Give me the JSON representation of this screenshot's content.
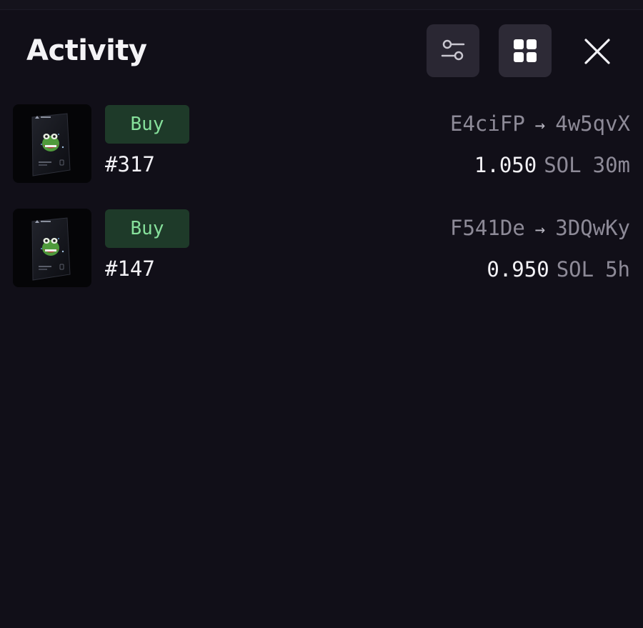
{
  "header": {
    "title": "Activity",
    "filter_icon": "sliders-icon",
    "grid_icon": "grid-icon",
    "close_icon": "close-icon"
  },
  "colors": {
    "background": "#110f18",
    "buy_badge_bg": "#1e3a29",
    "buy_badge_text": "#86e09b",
    "muted_text": "#8d8a97"
  },
  "activities": [
    {
      "type": "Buy",
      "token": "#317",
      "from": "E4ciFP",
      "to": "4w5qvX",
      "price": "1.050",
      "currency": "SOL",
      "age": "30m"
    },
    {
      "type": "Buy",
      "token": "#147",
      "from": "F541De",
      "to": "3DQwKy",
      "price": "0.950",
      "currency": "SOL",
      "age": "5h"
    }
  ]
}
